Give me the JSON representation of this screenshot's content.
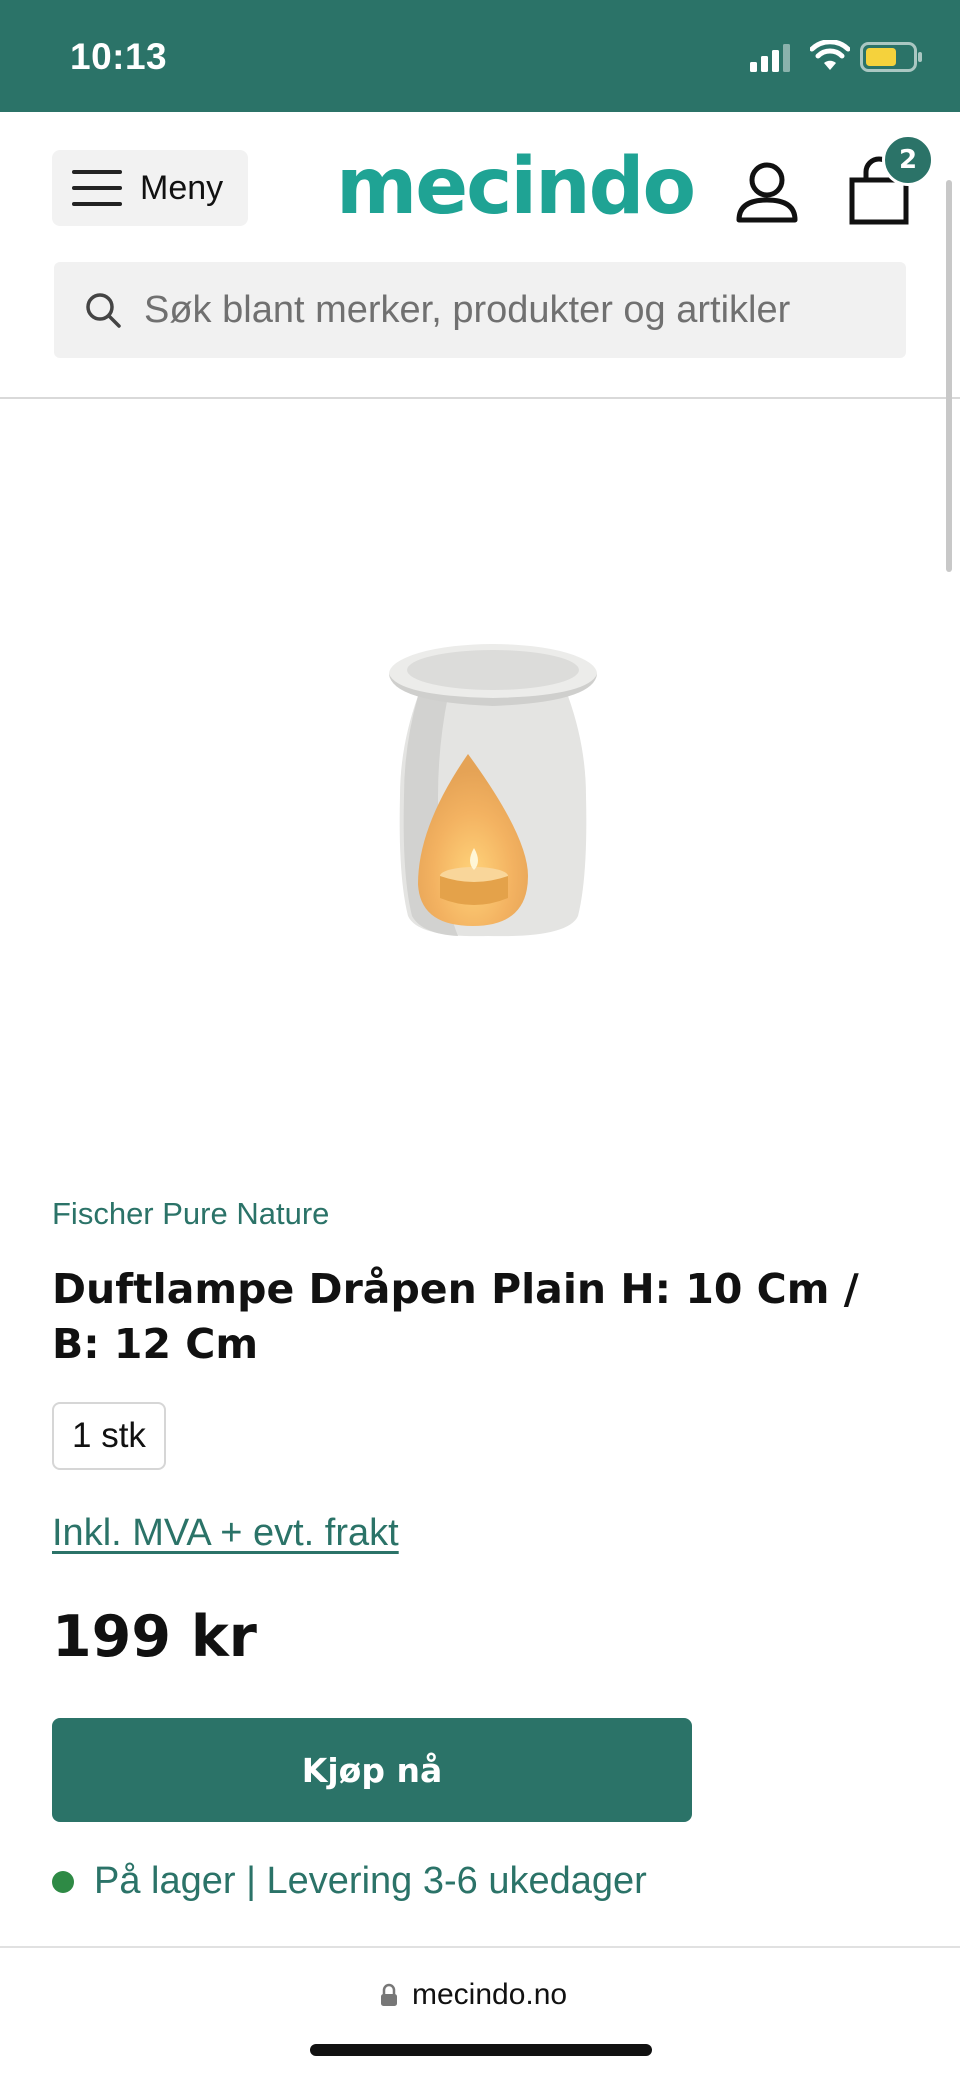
{
  "status_bar": {
    "time": "10:13"
  },
  "header": {
    "menu_label": "Meny",
    "logo_text": "mecindo",
    "cart_count": "2",
    "search_placeholder": "Søk blant merker, produkter og artikler"
  },
  "product": {
    "brand": "Fischer Pure Nature",
    "title": "Duftlampe Dråpen Plain H: 10 Cm / B: 12 Cm",
    "quantity": "1 stk",
    "vat_link": "Inkl. MVA + evt. frakt",
    "price": "199 kr",
    "buy_label": "Kjøp nå",
    "stock_status": "På lager | Levering 3-6 ukedager"
  },
  "browser": {
    "domain": "mecindo.no"
  },
  "colors": {
    "brand_green": "#2b7368",
    "logo_teal": "#1fa394",
    "stock_dot": "#2e8a45"
  },
  "icons": {
    "menu": "hamburger-icon",
    "search": "search-icon",
    "account": "user-icon",
    "cart": "shopping-bag-icon",
    "lock": "lock-icon"
  }
}
